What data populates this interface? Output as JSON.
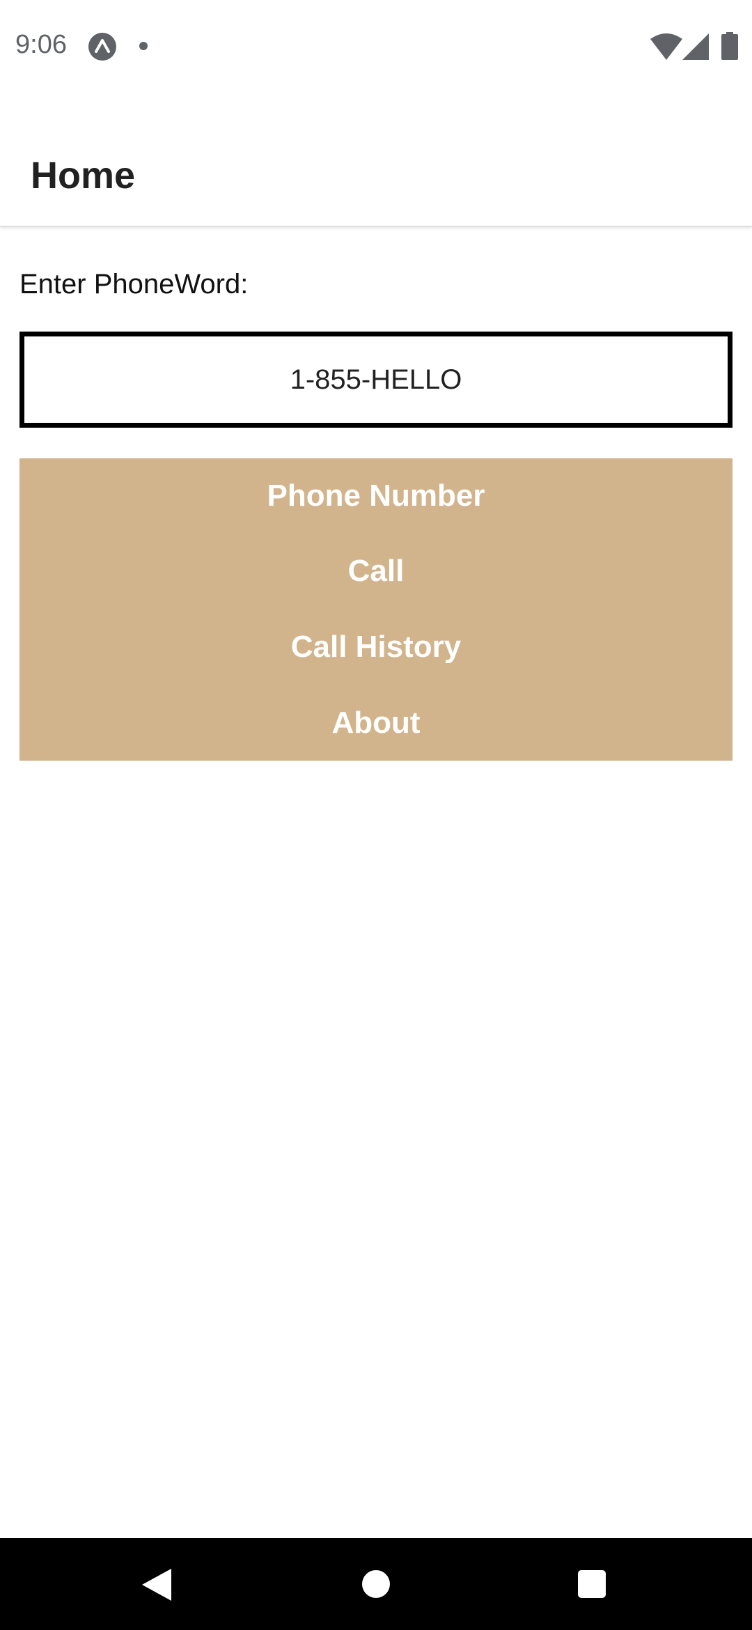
{
  "status_bar": {
    "time": "9:06",
    "icons": [
      "expo-app-icon",
      "notification-dot-icon",
      "wifi-icon",
      "cell-signal-icon",
      "battery-icon"
    ],
    "icon_color": "#5f6368"
  },
  "app_bar": {
    "title": "Home"
  },
  "main": {
    "prompt_label": "Enter PhoneWord:",
    "phoneword_input": {
      "value": "1-855-HELLO",
      "placeholder": ""
    },
    "buttons": [
      {
        "label": "Phone Number"
      },
      {
        "label": "Call"
      },
      {
        "label": "Call History"
      },
      {
        "label": "About"
      }
    ],
    "button_panel_color": "#d2b48c",
    "button_text_color": "#ffffff"
  },
  "nav_bar": {
    "icons": [
      "back-icon",
      "home-icon",
      "recents-icon"
    ],
    "background": "#000000"
  }
}
